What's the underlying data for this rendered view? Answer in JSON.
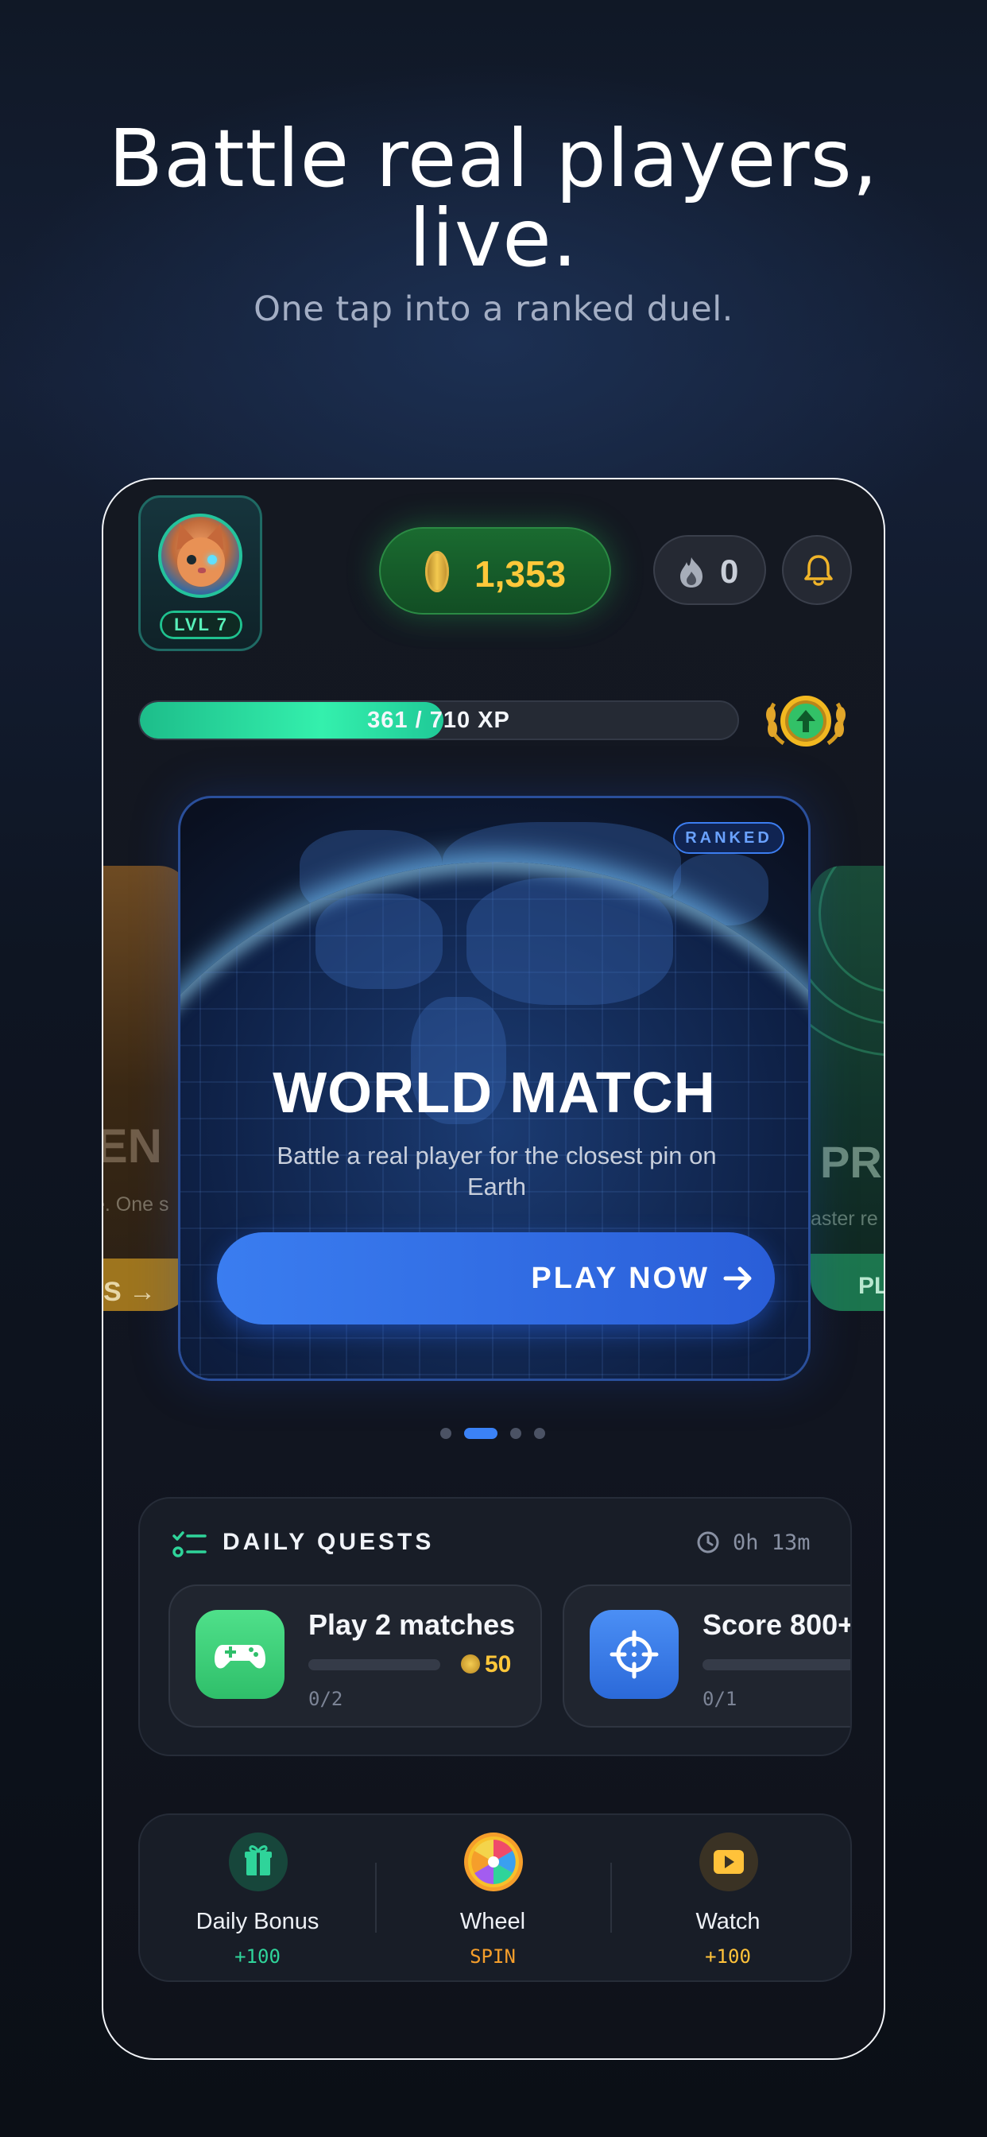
{
  "promo": {
    "headline_line1": "Battle real players,",
    "headline_line2": "live.",
    "subheadline": "One tap into a ranked duel."
  },
  "header": {
    "level_label": "LVL 7",
    "coins": "1,353",
    "streak_count": "0"
  },
  "xp": {
    "current": 361,
    "max": 710,
    "label": "361 / 710 XP"
  },
  "carousel": {
    "left_card": {
      "title_fragment": "LEN",
      "desc_fragment": "e. One s",
      "button_fragment": "S →"
    },
    "main_card": {
      "badge": "RANKED",
      "title": "WORLD MATCH",
      "description": "Battle a real player for the closest pin on Earth",
      "button_label": "PLAY NOW"
    },
    "right_card": {
      "title_fragment": "PR",
      "desc_fragment": "aster re",
      "button_fragment": "PL"
    },
    "page_count": 4,
    "active_index": 1
  },
  "quests": {
    "title": "DAILY QUESTS",
    "timer": "0h 13m",
    "items": [
      {
        "name": "Play 2 matches",
        "reward": "50",
        "progress": "0/2",
        "icon": "gamepad-icon"
      },
      {
        "name": "Score 800+",
        "progress": "0/1",
        "icon": "crosshair-icon"
      }
    ]
  },
  "actions": [
    {
      "name": "Daily Bonus",
      "sub": "+100",
      "icon": "gift-icon",
      "color": "#2fd49a"
    },
    {
      "name": "Wheel",
      "sub": "SPIN",
      "icon": "wheel-icon",
      "color": "#f59e2b"
    },
    {
      "name": "Watch",
      "sub": "+100",
      "icon": "play-video-icon",
      "color": "#ffc23a"
    }
  ],
  "colors": {
    "accent_blue": "#3b82f6",
    "coin_gold": "#ffc83a",
    "xp_green": "#34f0ad",
    "coin_pill_green": "#1a6b30"
  }
}
